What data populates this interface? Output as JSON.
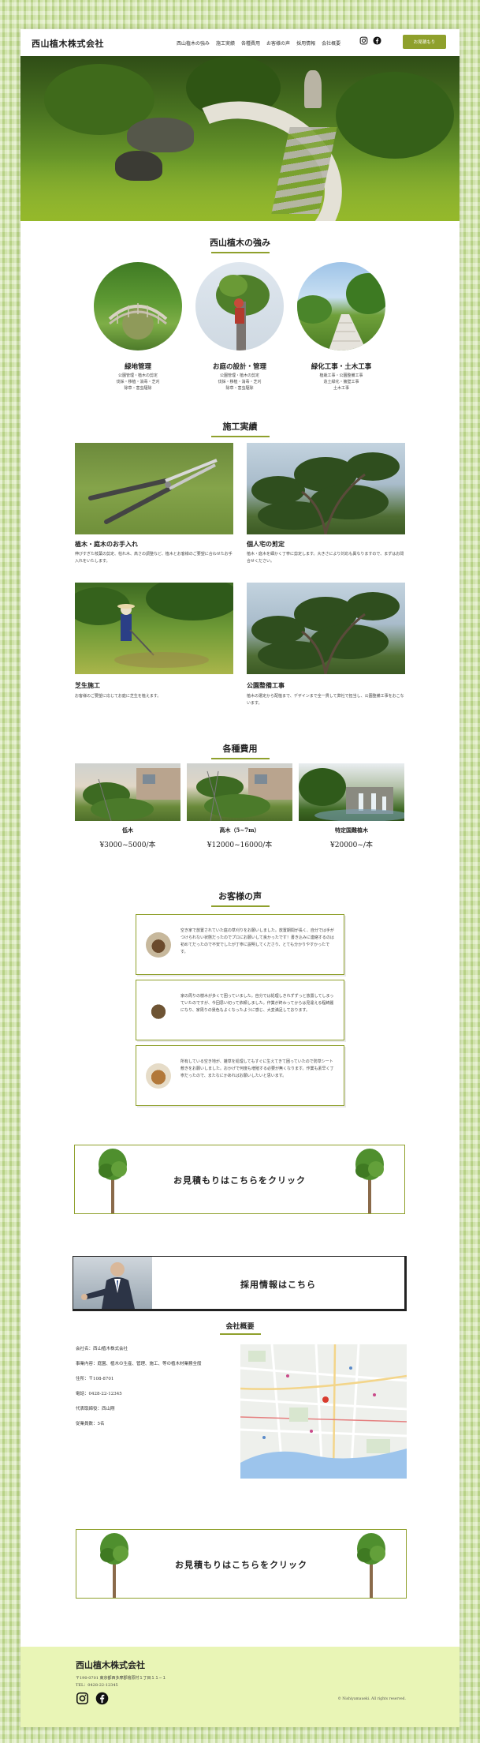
{
  "header": {
    "logo": "西山植木株式会社",
    "nav": [
      "西山植木の強み",
      "施工実績",
      "各種費用",
      "お客様の声",
      "採用情報",
      "会社概要"
    ],
    "cta": "お見積もり",
    "sns": [
      "instagram-icon",
      "facebook-icon"
    ]
  },
  "strengths": {
    "title": "西山植木の強み",
    "items": [
      {
        "title": "緑地管理",
        "desc": "公園管理・植木の剪定\n伐採・移植・消毒・芝刈\n除草・害虫駆除"
      },
      {
        "title": "お庭の設計・管理",
        "desc": "公園管理・植木の剪定\n伐採・移植・消毒・芝刈\n除草・害虫駆除"
      },
      {
        "title": "緑化工事・土木工事",
        "desc": "植栽工事・公園整備工事\n造土緑化・擁壁工事\n土木工事"
      }
    ]
  },
  "works": {
    "title": "施工実績",
    "items": [
      {
        "title": "植木・庭木のお手入れ",
        "desc": "伸びすぎた枝葉の剪定、枯れ木、高さの調整など、植木とお客様のご要望に合わせたお手入れをいたします。"
      },
      {
        "title": "個人宅の剪定",
        "desc": "植木・庭木を細かく丁寧に剪定します。大きさにより対応も異なりますので、まずはお問合せください。"
      },
      {
        "title": "芝生施工",
        "desc": "お客様のご要望に応じてお庭に芝生を植えます。"
      },
      {
        "title": "公園整備工事",
        "desc": "植木の選定から配植まで、デザインまで全一貫して弊社で担当し、公園整備工事をおこないます。"
      }
    ]
  },
  "costs": {
    "title": "各種費用",
    "items": [
      {
        "name": "低木",
        "price": "¥3000~5000/本"
      },
      {
        "name": "高木（5~7m）",
        "price": "¥12000~16000/本"
      },
      {
        "name": "特定国難植木",
        "price": "¥20000~/本"
      }
    ]
  },
  "voices": {
    "title": "お客様の声",
    "items": [
      "空き家で放置されていた庭の草刈りをお願いしました。放置期間が長く、自分では手がつけられない状態だったのでプロにお願いして良かったです！書き込みに連絡するのは初めてだったので不安でしたが丁寧に説明してくださり、とても分かりやすかったです。",
      "家の周りの樹木が多くて困っていました。自分では処理しきれずずっと放置してしまっていたのですが、今回思い切って依頼しました。作業が終わってからは見違える程綺麗になり、家周りの景色もよくなったように感じ、大変満足しております。",
      "所有している空き地が、雑草を処理してもすぐに生えてきて困っていたので防草シート敷きをお願いしました。おかげで何度も増殖する必要が無くなります。作業も素早く丁寧だったので、またなにかあればお願いしたいと思います。"
    ]
  },
  "banners": {
    "estimate": "お見積もりはこちらをクリック",
    "recruit": "採用情報はこちら"
  },
  "company": {
    "title": "会社概要",
    "rows": [
      "会社名：西山植木株式会社",
      "事業内容：庭園、植木の生産、管理、施工、等の植木材業務全般",
      "住所：〒108-8701",
      "電話：0428-22-12345",
      "代表取締役：西山剛",
      "従業員数：5名"
    ]
  },
  "footer": {
    "logo": "西山植木株式会社",
    "address": "〒190-0701 東京都西多摩郡檜原村１丁目１１−１",
    "tel": "TEL：0428-22-12345",
    "copyright": "© Nishiyamaueki. All rights reserved."
  },
  "colors": {
    "accent": "#8fa02c",
    "footer_bg": "#e9f5b6",
    "page_bg": "#cfe3a4"
  }
}
